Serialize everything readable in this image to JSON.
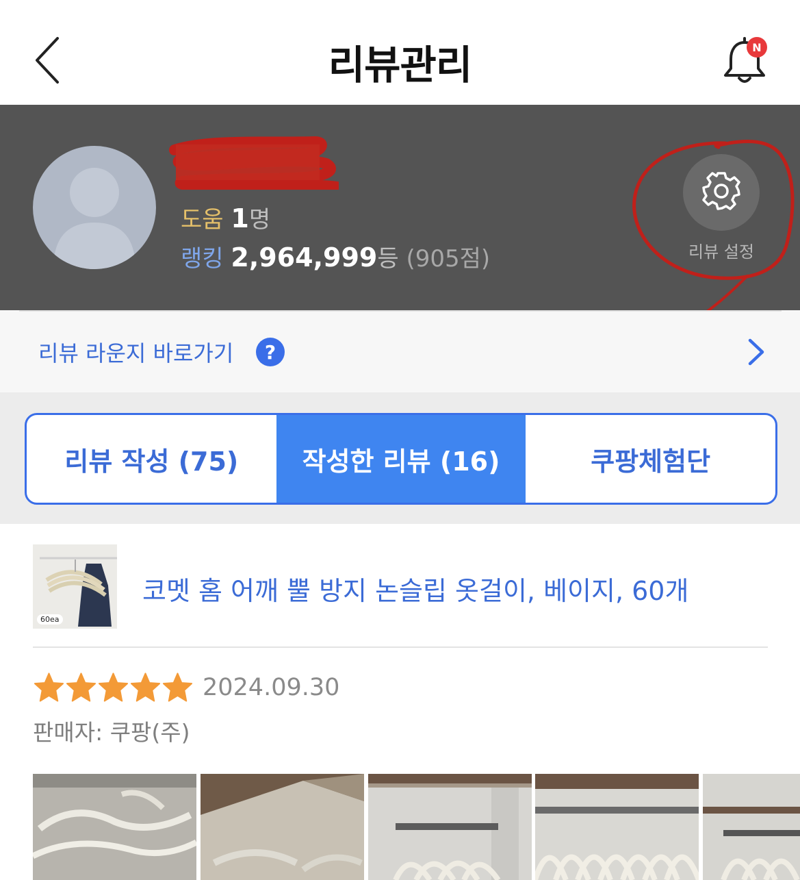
{
  "header": {
    "title": "리뷰관리",
    "notification_badge": "N"
  },
  "profile": {
    "help_label": "도움",
    "help_count": "1",
    "help_unit": "명",
    "rank_label": "랭킹",
    "rank_value": "2,964,999",
    "rank_unit": "등",
    "points": "(905점)",
    "settings_label": "리뷰 설정"
  },
  "lounge": {
    "label": "리뷰 라운지 바로가기",
    "help_glyph": "?"
  },
  "tabs": [
    {
      "label": "리뷰 작성 (75)",
      "active": false
    },
    {
      "label": "작성한 리뷰 (16)",
      "active": true
    },
    {
      "label": "쿠팡체험단",
      "active": false
    }
  ],
  "product": {
    "name": "코멧 홈 어깨 뿔 방지 논슬립 옷걸이, 베이지, 60개",
    "thumb_badge": "60ea"
  },
  "review": {
    "rating": 5,
    "date": "2024.09.30",
    "seller": "판매자: 쿠팡(주)"
  },
  "colors": {
    "accent": "#3f85f0",
    "link": "#3b6bd6",
    "star": "#f39a37",
    "profile_bg": "#545454",
    "badge": "#e8393b"
  },
  "icons": {
    "back": "chevron-left-icon",
    "bell": "bell-icon",
    "settings": "gear-icon",
    "help": "question-icon",
    "forward": "chevron-right-icon",
    "star": "star-icon"
  }
}
